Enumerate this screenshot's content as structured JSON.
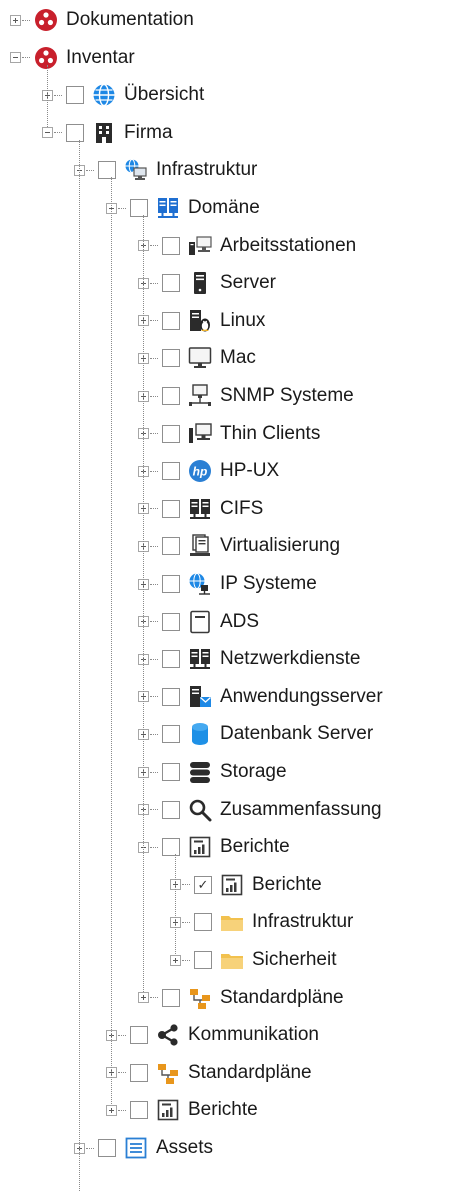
{
  "tree": {
    "items": [
      {
        "label": "Dokumentation",
        "icon": "docusnap-logo-icon",
        "expanded": false,
        "checkbox": false
      },
      {
        "label": "Inventar",
        "icon": "docusnap-logo-icon",
        "expanded": true,
        "checkbox": false
      },
      {
        "label": "Übersicht",
        "icon": "globe-icon",
        "expanded": false,
        "checkbox": true,
        "checked": false
      },
      {
        "label": "Firma",
        "icon": "building-icon",
        "expanded": true,
        "checkbox": true,
        "checked": false
      },
      {
        "label": "Infrastruktur",
        "icon": "network-globe-computer-icon",
        "expanded": true,
        "checkbox": true,
        "checked": false
      },
      {
        "label": "Domäne",
        "icon": "domain-servers-icon",
        "expanded": true,
        "checkbox": true,
        "checked": false
      },
      {
        "label": "Arbeitsstationen",
        "icon": "workstations-icon",
        "expanded": false,
        "checkbox": true,
        "checked": false
      },
      {
        "label": "Server",
        "icon": "server-tower-icon",
        "expanded": false,
        "checkbox": true,
        "checked": false
      },
      {
        "label": "Linux",
        "icon": "linux-server-icon",
        "expanded": false,
        "checkbox": true,
        "checked": false
      },
      {
        "label": "Mac",
        "icon": "monitor-icon",
        "expanded": false,
        "checkbox": true,
        "checked": false
      },
      {
        "label": "SNMP Systeme",
        "icon": "snmp-network-icon",
        "expanded": false,
        "checkbox": true,
        "checked": false
      },
      {
        "label": "Thin Clients",
        "icon": "thin-client-icon",
        "expanded": false,
        "checkbox": true,
        "checked": false
      },
      {
        "label": "HP-UX",
        "icon": "hp-logo-icon",
        "expanded": false,
        "checkbox": true,
        "checked": false
      },
      {
        "label": "CIFS",
        "icon": "cifs-servers-icon",
        "expanded": false,
        "checkbox": true,
        "checked": false
      },
      {
        "label": "Virtualisierung",
        "icon": "virtualization-icon",
        "expanded": false,
        "checkbox": true,
        "checked": false
      },
      {
        "label": "IP Systeme",
        "icon": "ip-globe-icon",
        "expanded": false,
        "checkbox": true,
        "checked": false
      },
      {
        "label": "ADS",
        "icon": "ads-server-icon",
        "expanded": false,
        "checkbox": true,
        "checked": false
      },
      {
        "label": "Netzwerkdienste",
        "icon": "network-services-icon",
        "expanded": false,
        "checkbox": true,
        "checked": false
      },
      {
        "label": "Anwendungsserver",
        "icon": "application-server-icon",
        "expanded": false,
        "checkbox": true,
        "checked": false
      },
      {
        "label": "Datenbank Server",
        "icon": "database-icon",
        "expanded": false,
        "checkbox": true,
        "checked": false
      },
      {
        "label": "Storage",
        "icon": "storage-icon",
        "expanded": false,
        "checkbox": true,
        "checked": false
      },
      {
        "label": "Zusammenfassung",
        "icon": "magnifier-icon",
        "expanded": false,
        "checkbox": true,
        "checked": false
      },
      {
        "label": "Berichte",
        "icon": "report-chart-icon",
        "expanded": true,
        "checkbox": true,
        "checked": false
      },
      {
        "label": "Berichte",
        "icon": "report-chart-icon",
        "expanded": false,
        "checkbox": true,
        "checked": true
      },
      {
        "label": "Infrastruktur",
        "icon": "folder-icon",
        "expanded": false,
        "checkbox": true,
        "checked": false
      },
      {
        "label": "Sicherheit",
        "icon": "folder-icon",
        "expanded": false,
        "checkbox": true,
        "checked": false
      },
      {
        "label": "Standardpläne",
        "icon": "standard-plans-icon",
        "expanded": false,
        "checkbox": true,
        "checked": false
      },
      {
        "label": "Kommunikation",
        "icon": "share-icon",
        "expanded": false,
        "checkbox": true,
        "checked": false
      },
      {
        "label": "Standardpläne",
        "icon": "standard-plans-icon",
        "expanded": false,
        "checkbox": true,
        "checked": false
      },
      {
        "label": "Berichte",
        "icon": "report-chart-icon",
        "expanded": false,
        "checkbox": true,
        "checked": false
      },
      {
        "label": "Assets",
        "icon": "assets-list-icon",
        "expanded": false,
        "checkbox": true,
        "checked": false
      }
    ]
  },
  "colors": {
    "brand_red": "#c8202c",
    "globe_blue": "#1e88e5",
    "folder_yellow": "#f2c14e",
    "plans_orange": "#e8961c",
    "dark_icon": "#2b2b2b"
  }
}
